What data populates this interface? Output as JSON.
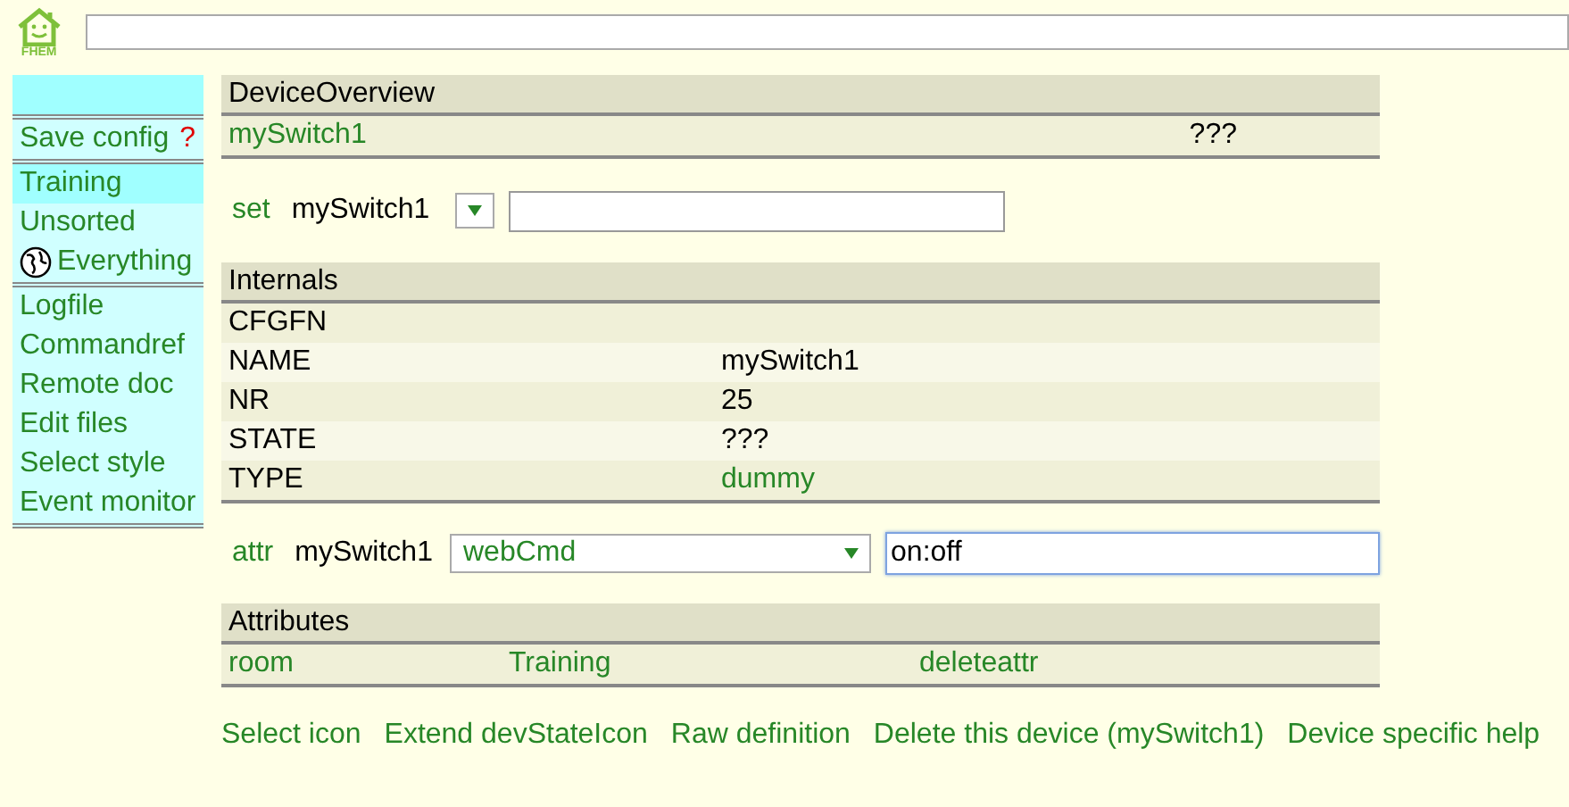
{
  "logo": {
    "text": "FHEM"
  },
  "sidebar": {
    "groups": [
      {
        "items": [
          {
            "label": "Save config",
            "badge": "?",
            "kind": "save",
            "selected": false
          }
        ]
      },
      {
        "items": [
          {
            "label": "Training",
            "kind": "room",
            "selected": true
          },
          {
            "label": "Unsorted",
            "kind": "room",
            "selected": false
          },
          {
            "label": "Everything",
            "kind": "globe",
            "selected": false
          }
        ]
      },
      {
        "items": [
          {
            "label": "Logfile",
            "kind": "room",
            "selected": false
          },
          {
            "label": "Commandref",
            "kind": "room",
            "selected": false
          },
          {
            "label": "Remote doc",
            "kind": "room",
            "selected": false
          },
          {
            "label": "Edit files",
            "kind": "room",
            "selected": false
          },
          {
            "label": "Select style",
            "kind": "room",
            "selected": false
          },
          {
            "label": "Event monitor",
            "kind": "room",
            "selected": false
          }
        ]
      }
    ]
  },
  "device_overview": {
    "title": "DeviceOverview",
    "device": "mySwitch1",
    "state": "???"
  },
  "set_line": {
    "label": "set",
    "device": "mySwitch1"
  },
  "internals": {
    "title": "Internals",
    "rows": [
      {
        "name": "CFGFN"
      },
      {
        "name": "NAME",
        "value": "mySwitch1",
        "linked": false
      },
      {
        "name": "NR",
        "value": "25",
        "linked": false
      },
      {
        "name": "STATE",
        "value": "???",
        "linked": false
      },
      {
        "name": "TYPE",
        "value": "dummy",
        "linked": true
      }
    ]
  },
  "attr_line": {
    "label": "attr",
    "device": "mySwitch1",
    "attribute": "webCmd",
    "value": "on:off"
  },
  "attributes": {
    "title": "Attributes",
    "rows": [
      {
        "name": "room",
        "value": "Training",
        "action": "deleteattr"
      }
    ]
  },
  "links": [
    "Select icon",
    "Extend devStateIcon",
    "Raw definition",
    "Delete this device (mySwitch1)",
    "Device specific help"
  ]
}
